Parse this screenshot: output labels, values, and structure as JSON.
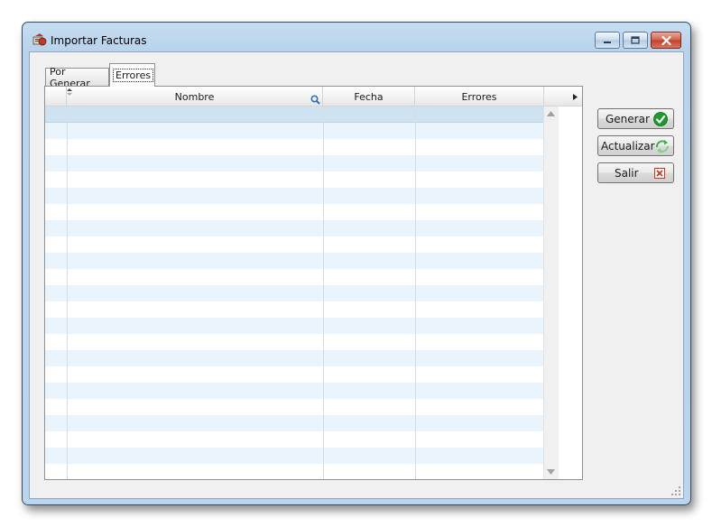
{
  "window": {
    "title": "Importar Facturas",
    "icon": "app-icon",
    "caption_buttons": [
      "minimize-icon",
      "maximize-icon",
      "close-icon"
    ]
  },
  "tabs": [
    {
      "label": "Por Generar",
      "active": false
    },
    {
      "label": "Errores",
      "active": true
    }
  ],
  "grid": {
    "columns": [
      {
        "label": "Nombre",
        "icon": "search-icon"
      },
      {
        "label": "Fecha"
      },
      {
        "label": "Errores"
      }
    ],
    "row_count": 23,
    "selected_row": 0,
    "stripe_color": "#eaf4fc",
    "selection_color": "#cfe2f1"
  },
  "buttons": {
    "generar": {
      "label": "Generar",
      "icon": "check-icon",
      "color": "#1e9a2c"
    },
    "actualizar": {
      "label": "Actualizar",
      "icon": "refresh-icon",
      "color": "#3cb043"
    },
    "salir": {
      "label": "Salir",
      "icon": "close-icon",
      "color": "#c0392b"
    }
  }
}
